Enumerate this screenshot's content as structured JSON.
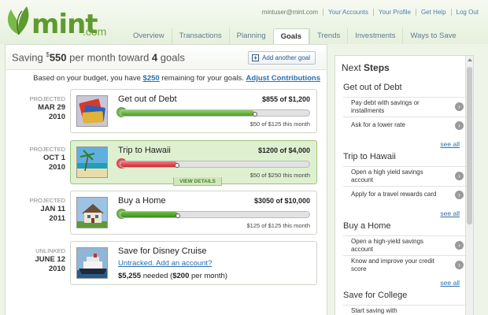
{
  "header": {
    "logo_text": "mint",
    "logo_suffix": ".com",
    "user_email": "mintuser@mint.com",
    "links": [
      "Your Accounts",
      "Your Profile",
      "Get Help",
      "Log Out"
    ],
    "tabs": [
      "Overview",
      "Transactions",
      "Planning",
      "Goals",
      "Trends",
      "Investments",
      "Ways to Save"
    ],
    "active_tab": "Goals"
  },
  "summary": {
    "prefix": "Saving ",
    "currency": "$",
    "amount": "550",
    "middle": " per month toward ",
    "count": "4",
    "suffix": " goals",
    "add_button": "Add another goal"
  },
  "budget": {
    "text1": "Based on your budget, you have ",
    "remaining": "$250",
    "text2": " remaining for your goals. ",
    "adjust": "Adjust Contributions"
  },
  "goals": [
    {
      "status": "PROJECTED",
      "date": "MAR 29",
      "year": "2010",
      "name": "Get out of Debt",
      "amount": "$855 of $1,200",
      "progress": 0.71,
      "month_text": "$50 of $125 this month",
      "color": "#4e9b27"
    },
    {
      "status": "PROJECTED",
      "date": "OCT 1",
      "year": "2010",
      "name": "Trip to Hawaii",
      "amount": "$1200 of $4,000",
      "progress": 0.3,
      "month_text": "$50 of $250 this month",
      "color": "#d2262f",
      "details": "VIEW DETAILS"
    },
    {
      "status": "PROJECTED",
      "date": "JAN 11",
      "year": "2011",
      "name": "Buy a Home",
      "amount": "$3050 of $10,000",
      "progress": 0.305,
      "month_text": "$125 of $125 this month",
      "color": "#3c8a1f"
    },
    {
      "status": "UNLINKED",
      "date": "JUNE 12",
      "year": "2010",
      "name": "Save for Disney Cruise",
      "link": "Untracked. Add an account?",
      "needed_amount": "$5,255",
      "needed_mid": " needed (",
      "needed_month": "$200",
      "needed_end": " per month)"
    }
  ],
  "next_steps": {
    "title_light": "Next ",
    "title_bold": "Steps",
    "sections": [
      {
        "name": "Get out of Debt",
        "items": [
          "Pay debt with savings or installments",
          "Ask for a lower rate"
        ],
        "see_all": "see all"
      },
      {
        "name": "Trip to Hawaii",
        "items": [
          "Open a high yield savings account",
          "Apply for a travel rewards card"
        ],
        "see_all": "see all"
      },
      {
        "name": "Buy a Home",
        "items": [
          "Open a high-yield savings account",
          "Know and improve your credit score"
        ],
        "see_all": "see all"
      },
      {
        "name": "Save for College",
        "items": [
          "Start saving with"
        ]
      }
    ]
  },
  "colors": {
    "brand": "#5e9b2e",
    "link": "#2a6fb0",
    "selected_bg": "#dff0d0"
  }
}
